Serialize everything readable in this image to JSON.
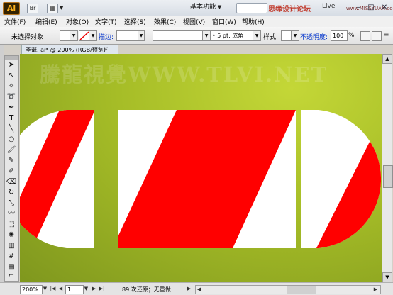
{
  "titlebar": {
    "logo": "Ai",
    "workspace": "基本功能",
    "live": "Live"
  },
  "watermarks": {
    "top_right_cn": "思缘设计论坛",
    "top_right_url": "www.MISSYUAN.com",
    "canvas_overlay": "騰龍視覺WWW.TLVI.NET"
  },
  "menu": [
    "文件(F)",
    "编辑(E)",
    "对象(O)",
    "文字(T)",
    "选择(S)",
    "效果(C)",
    "视图(V)",
    "窗口(W)",
    "帮助(H)"
  ],
  "control_bar": {
    "selection_label": "未选择对象",
    "stroke_label": "描边:",
    "brush_value": "5 pt. 成角",
    "style_label": "样式:",
    "opacity_label": "不透明度:",
    "opacity_value": "100",
    "opacity_unit": "%"
  },
  "document": {
    "tab_title": "圣诞. ai* @ 200% (RGB/预览)",
    "close": "×"
  },
  "status_bar": {
    "zoom": "200%",
    "page": "1",
    "info": "89 次还原；无重做"
  },
  "colors": {
    "stripe_red": "#ff0000",
    "white": "#ffffff",
    "canvas_green": "#a6bd27"
  },
  "tools": [
    "selection-arrow",
    "direct-select",
    "magic-wand",
    "lasso",
    "pen",
    "type",
    "line",
    "ellipse",
    "paintbrush",
    "pencil",
    "blob-brush",
    "eraser",
    "rotate",
    "scale",
    "warp",
    "free-transform",
    "symbol-sprayer",
    "graph",
    "mesh",
    "gradient",
    "eyedropper",
    "blend",
    "scissors",
    "hand",
    "zoom"
  ]
}
